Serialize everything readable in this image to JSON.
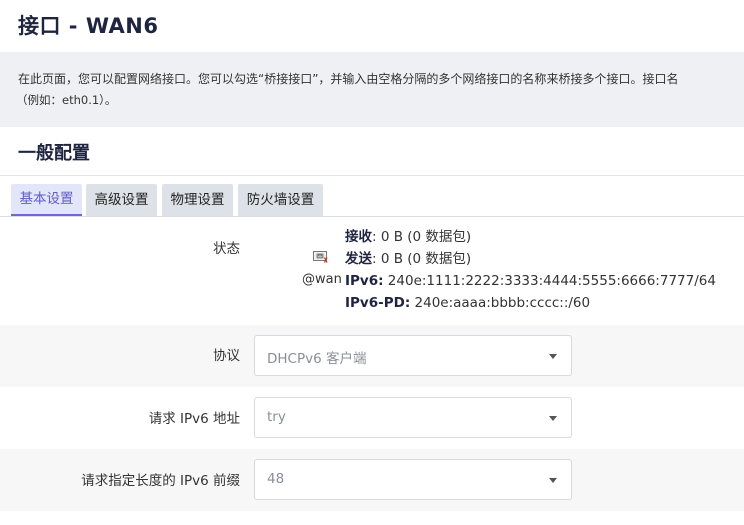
{
  "page": {
    "title": "接口 - WAN6",
    "description_line1": "在此页面，您可以配置网络接口。您可以勾选“桥接接口”，并输入由空格分隔的多个网络接口的名称来桥接多个接口。接口名",
    "description_line2": "（例如：eth0.1）。"
  },
  "section": {
    "title": "一般配置"
  },
  "tabs": [
    {
      "label": "基本设置",
      "active": true
    },
    {
      "label": "高级设置",
      "active": false
    },
    {
      "label": "物理设置",
      "active": false
    },
    {
      "label": "防火墙设置",
      "active": false
    }
  ],
  "status": {
    "label": "状态",
    "device_icon": "ethernet-port-icon",
    "device": "@wan",
    "rx_label": "接收",
    "rx_value": ": 0 B (0 数据包)",
    "tx_label": "发送",
    "tx_value": ": 0 B (0 数据包)",
    "ipv6_label": "IPv6:",
    "ipv6_value": " 240e:1111:2222:3333:4444:5555:6666:7777/64",
    "ipv6pd_label": "IPv6-PD:",
    "ipv6pd_value": " 240e:aaaa:bbbb:cccc::/60"
  },
  "fields": [
    {
      "label": "协议",
      "value": "DHCPv6 客户端"
    },
    {
      "label": "请求 IPv6 地址",
      "value": "try"
    },
    {
      "label": "请求指定长度的 IPv6 前缀",
      "value": "48"
    }
  ],
  "colors": {
    "accent": "#6b69d6",
    "title": "#1f2440",
    "description_bg": "#eef0f3",
    "tab_bg": "#dde2e8"
  }
}
